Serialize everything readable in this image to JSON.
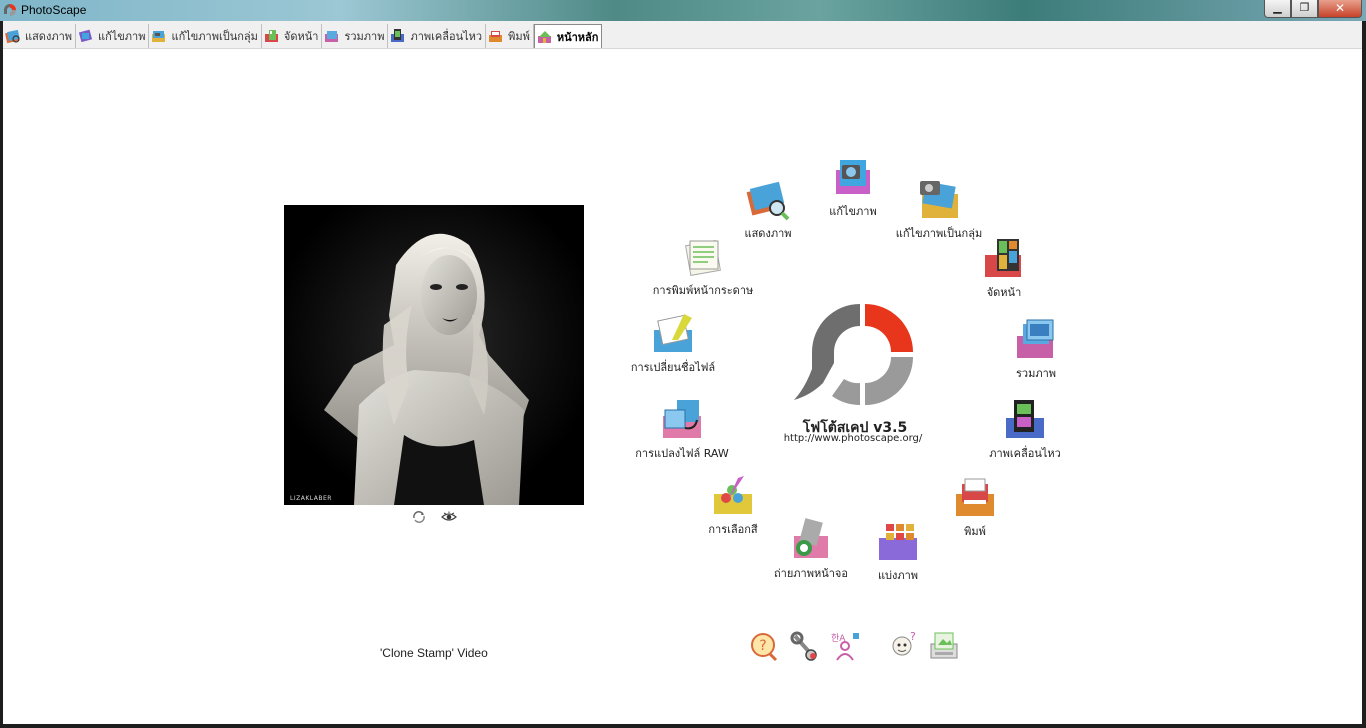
{
  "window": {
    "title": "PhotoScape"
  },
  "tabs": [
    {
      "label": "แสดงภาพ",
      "icon": "viewer-icon"
    },
    {
      "label": "แก้ไขภาพ",
      "icon": "editor-icon"
    },
    {
      "label": "แก้ไขภาพเป็นกลุ่ม",
      "icon": "batch-editor-icon"
    },
    {
      "label": "จัดหน้า",
      "icon": "page-icon"
    },
    {
      "label": "รวมภาพ",
      "icon": "combine-icon"
    },
    {
      "label": "ภาพเคลื่อนไหว",
      "icon": "animated-gif-icon"
    },
    {
      "label": "พิมพ์",
      "icon": "print-icon"
    },
    {
      "label": "หน้าหลัก",
      "icon": "home-icon",
      "active": true
    }
  ],
  "preview": {
    "caption": "LIZAKLABER",
    "video_link": "'Clone Stamp' Video"
  },
  "menu": {
    "viewer": "แสดงภาพ",
    "editor": "แก้ไขภาพ",
    "batch": "แก้ไขภาพเป็นกลุ่ม",
    "page": "จัดหน้า",
    "combine": "รวมภาพ",
    "gif": "ภาพเคลื่อนไหว",
    "print": "พิมพ์",
    "splitter": "แบ่งภาพ",
    "screen_capture": "ถ่ายภาพหน้าจอ",
    "color_picker": "การเลือกสี",
    "raw_converter": "การแปลงไฟล์ RAW",
    "rename": "การเปลี่ยนชื่อไฟล์",
    "paper_print": "การพิมพ์หน้ากระดาษ"
  },
  "logo": {
    "title": "โฟโต้สเคป v3.5",
    "url": "http://www.photoscape.org/"
  },
  "bottom_icons": [
    "help-icon",
    "settings-icon",
    "language-icon",
    "about-icon",
    "screenshot-icon"
  ],
  "colors": {
    "accent": "#e8361c",
    "logo_gray": "#6e6e6e"
  }
}
